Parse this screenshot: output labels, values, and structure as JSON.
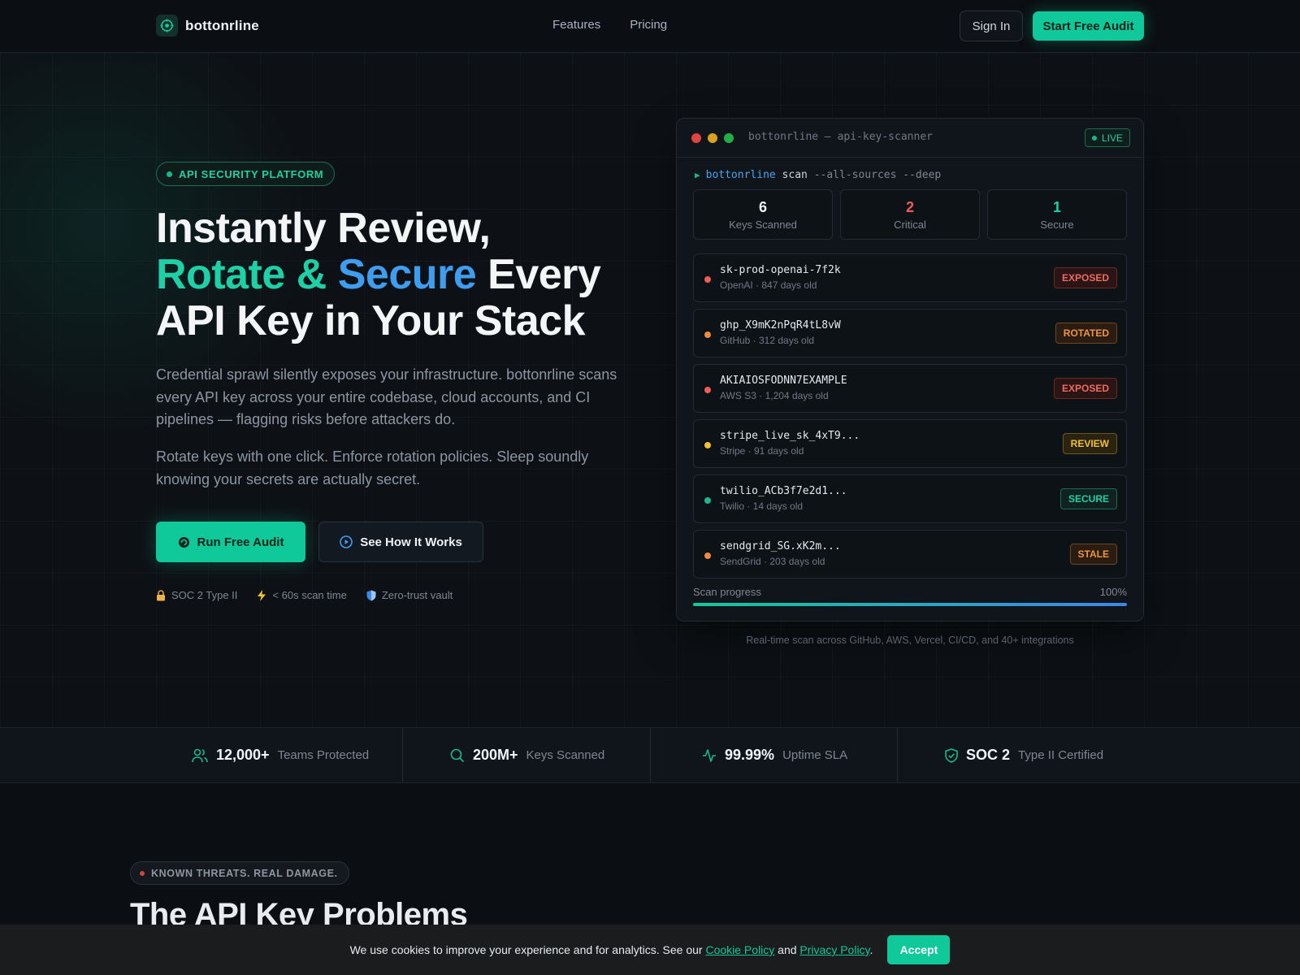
{
  "nav": {
    "brand": "bottonrline",
    "links": [
      "Features",
      "Pricing"
    ],
    "sign_in": "Sign In",
    "start": "Start Free Audit"
  },
  "hero": {
    "badge": "API SECURITY PLATFORM",
    "title_line1": "Instantly Review,",
    "title_accent_a": "Rotate &",
    "title_accent_b": "Secure",
    "title_line2_rest": "Every",
    "title_line3": "API Key in Your Stack",
    "lead": "Credential sprawl silently exposes your infrastructure. bottonrline scans every API key across your entire codebase, cloud accounts, and CI pipelines — flagging risks before attackers do.",
    "lead2": "Rotate keys with one click. Enforce rotation policies. Sleep soundly knowing your secrets are actually secret.",
    "cta_primary": "Run Free Audit",
    "cta_secondary": "See How It Works",
    "trust": [
      {
        "icon": "lock-icon",
        "text": "SOC 2 Type II"
      },
      {
        "icon": "lightning-icon",
        "text": "< 60s scan time"
      },
      {
        "icon": "shield-icon",
        "text": "Zero-trust vault"
      }
    ]
  },
  "terminal": {
    "title": "bottonrline — api-key-scanner",
    "live": "LIVE",
    "cmd_exe": "bottonrline",
    "cmd_sub": "scan",
    "cmd_args": "--all-sources --deep",
    "stats": [
      {
        "value": "6",
        "label": "Keys Scanned",
        "color": "#f2f5f8"
      },
      {
        "value": "2",
        "label": "Critical",
        "color": "#ef5d57"
      },
      {
        "value": "1",
        "label": "Secure",
        "color": "#1ed0a6"
      }
    ],
    "keys": [
      {
        "name": "sk-prod-openai-7f2k",
        "meta": "OpenAI · 847 days old",
        "status": "EXPOSED",
        "dot": "#ef5d57",
        "fg": "#ef6b62",
        "bg": "#2a1414",
        "border": "#6b2a27"
      },
      {
        "name": "ghp_X9mK2nPqR4tL8vW",
        "meta": "GitHub · 312 days old",
        "status": "ROTATED",
        "dot": "#f08a3c",
        "fg": "#f0953f",
        "bg": "#2a1c10",
        "border": "#6e4421"
      },
      {
        "name": "AKIAIOSFODNN7EXAMPLE",
        "meta": "AWS S3 · 1,204 days old",
        "status": "EXPOSED",
        "dot": "#ef5d57",
        "fg": "#ef6b62",
        "bg": "#2a1414",
        "border": "#6b2a27"
      },
      {
        "name": "stripe_live_sk_4xT9...",
        "meta": "Stripe · 91 days old",
        "status": "REVIEW",
        "dot": "#f2c230",
        "fg": "#f2c230",
        "bg": "#2a2310",
        "border": "#6b5820"
      },
      {
        "name": "twilio_ACb3f7e2d1...",
        "meta": "Twilio · 14 days old",
        "status": "SECURE",
        "dot": "#19b88c",
        "fg": "#1ed0a6",
        "bg": "#0f2220",
        "border": "#1b6b55"
      },
      {
        "name": "sendgrid_SG.xK2m...",
        "meta": "SendGrid · 203 days old",
        "status": "STALE",
        "dot": "#f08a3c",
        "fg": "#f0953f",
        "bg": "#2a1c10",
        "border": "#6e4421"
      }
    ],
    "progress_label": "Scan progress",
    "progress_text": "100%",
    "progress_value": 1.0
  },
  "caption": "Real-time scan across GitHub, AWS, Vercel, CI/CD, and 40+ integrations",
  "band": [
    {
      "icon": "users-icon",
      "value": "12,000+",
      "label": "Teams Protected"
    },
    {
      "icon": "search-icon",
      "value": "200M+",
      "label": "Keys Scanned"
    },
    {
      "icon": "activity-icon",
      "value": "99.99%",
      "label": "Uptime SLA"
    },
    {
      "icon": "shield-check-icon",
      "value": "SOC 2",
      "label": "Type II Certified"
    }
  ],
  "section": {
    "badge": "KNOWN THREATS. REAL DAMAGE.",
    "title": "The API Key Problems"
  },
  "cookie": {
    "text_before": "We use cookies to improve your experience and for analytics. See our",
    "link1": "Cookie Policy",
    "text_mid": "and",
    "link2": "Privacy Policy",
    "text_after": ".",
    "accept": "Accept"
  },
  "colors": {
    "accent": "#10c99a",
    "accent_blue": "#3f9df0",
    "background": "#0b0e12"
  }
}
